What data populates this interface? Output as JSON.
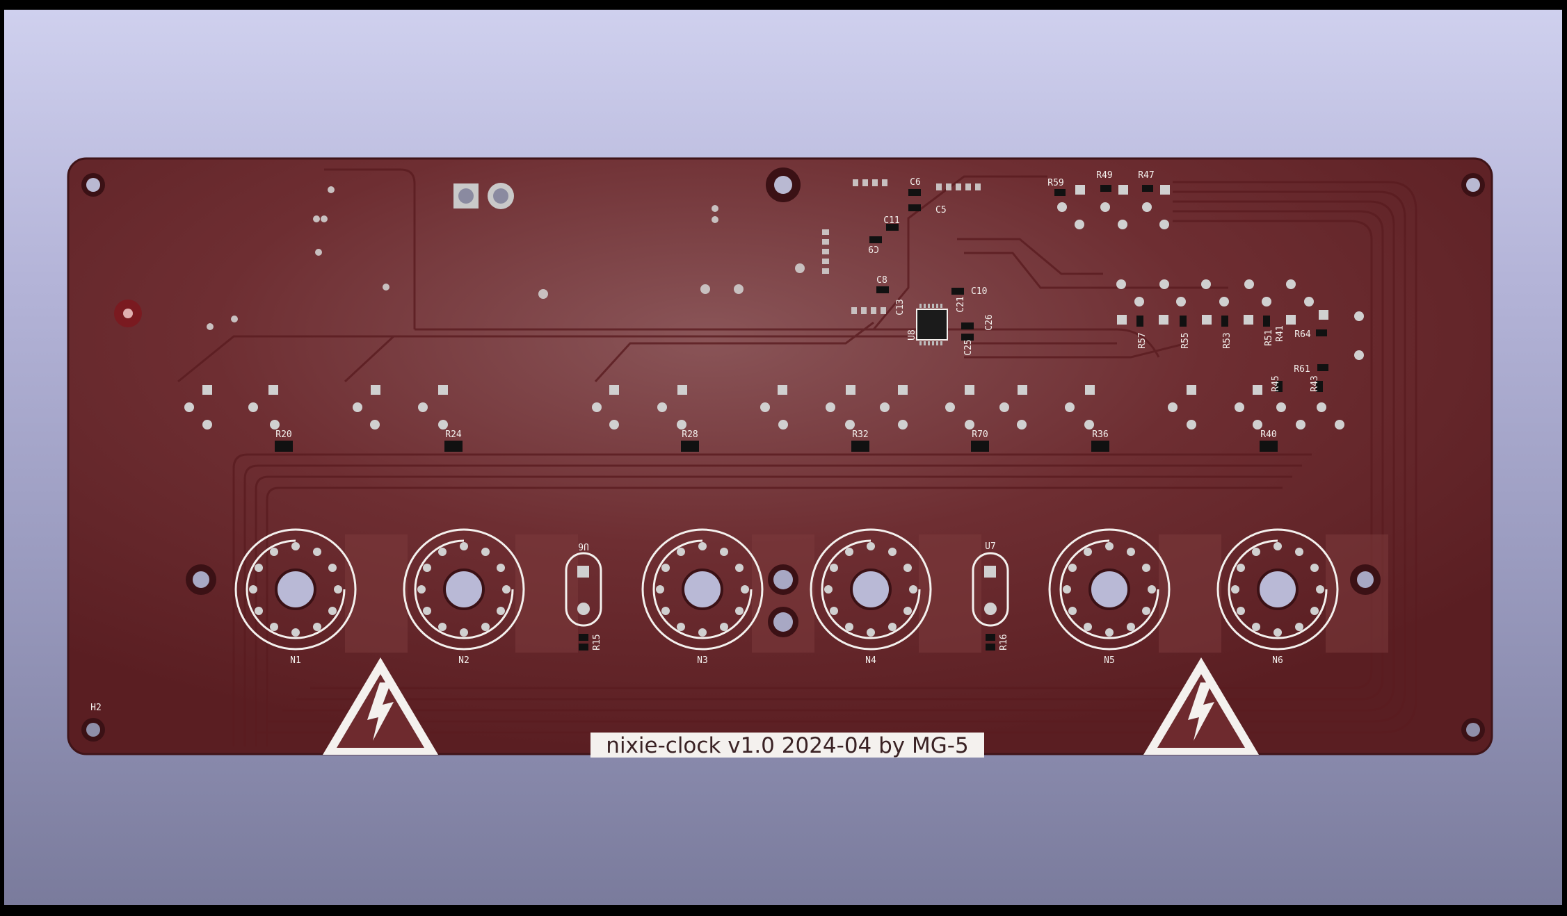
{
  "board": {
    "title_text": "nixie-clock v1.0 2024-04 by MG-5",
    "colors": {
      "background_top": "#cfd0ee",
      "background_bottom": "#7a7b9c",
      "soldermask": "#6e2a2e",
      "silkscreen": "#f4f1ee",
      "pad": "#c9c9c9"
    },
    "tubes": [
      "N1",
      "N2",
      "N3",
      "N4",
      "N5",
      "N6"
    ],
    "resistors_row": [
      "R20",
      "R24",
      "R28",
      "R32",
      "R70",
      "R36",
      "R40"
    ],
    "opto": [
      "U6",
      "U7"
    ],
    "opto_resistors": [
      "R15",
      "R16"
    ],
    "top_components": [
      "C6",
      "C5",
      "C11",
      "C9",
      "C8",
      "C10",
      "C13",
      "C21",
      "C25",
      "C26",
      "U8"
    ],
    "right_components": [
      "R59",
      "R49",
      "R47",
      "R57",
      "R55",
      "R53",
      "R51",
      "R41",
      "R64",
      "R61",
      "R45",
      "R43"
    ],
    "mounting_hole_label": "H2",
    "warning_icon": "high-voltage-warning-icon"
  }
}
